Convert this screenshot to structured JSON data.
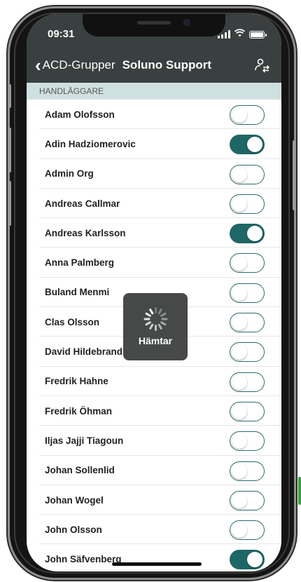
{
  "statusbar": {
    "time": "09:31"
  },
  "navbar": {
    "back_label": "ACD-Grupper",
    "title": "Soluno Support",
    "action_icon": "user-settings-icon"
  },
  "section": {
    "header": "HANDLÄGGARE"
  },
  "agents": [
    {
      "name": "Adam Olofsson",
      "enabled": false
    },
    {
      "name": "Adin Hadziomerovic",
      "enabled": true
    },
    {
      "name": "Admin Org",
      "enabled": false
    },
    {
      "name": "Andreas Callmar",
      "enabled": false
    },
    {
      "name": "Andreas Karlsson",
      "enabled": true
    },
    {
      "name": "Anna Palmberg",
      "enabled": false
    },
    {
      "name": "Buland Menmi",
      "enabled": false
    },
    {
      "name": "Clas Olsson",
      "enabled": false
    },
    {
      "name": "David Hildebrand",
      "enabled": false
    },
    {
      "name": "Fredrik Hahne",
      "enabled": false
    },
    {
      "name": "Fredrik Öhman",
      "enabled": false
    },
    {
      "name": "Iljas Jajji Tiagoun",
      "enabled": false
    },
    {
      "name": "Johan Sollenlid",
      "enabled": false
    },
    {
      "name": "Johan Wogel",
      "enabled": false
    },
    {
      "name": "John Olsson",
      "enabled": false
    },
    {
      "name": "John Säfvenberg",
      "enabled": true
    }
  ],
  "loader": {
    "label": "Hämtar"
  },
  "colors": {
    "bar_background": "#3a3f3f",
    "section_background": "#cfe0e0",
    "toggle_accent": "#1f6666"
  }
}
